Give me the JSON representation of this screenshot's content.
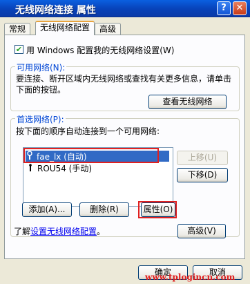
{
  "window": {
    "title": "无线网络连接 属性",
    "help": "?",
    "close": "✕"
  },
  "tabs": [
    {
      "label": "常规"
    },
    {
      "label": "无线网络配置"
    },
    {
      "label": "高级"
    }
  ],
  "use_windows": {
    "checked": true,
    "label": "用 Windows 配置我的无线网络设置(W)"
  },
  "available": {
    "legend": "可用网络(N):",
    "desc": "要连接、断开区域内无线网络或查找有关更多信息，请单击下面的按钮。",
    "view_button": "查看无线网络"
  },
  "preferred": {
    "legend": "首选网络(P):",
    "desc": "按下面的顺序自动连接到一个可用网络:",
    "items": [
      {
        "label": "fae_lx (自动)",
        "icon": "antenna-icon"
      },
      {
        "label": "ROU54 (手动)",
        "icon": "antenna-icon"
      }
    ],
    "up_button": "上移(U)",
    "down_button": "下移(D)",
    "add_button": "添加(A)...",
    "remove_button": "删除(R)",
    "properties_button": "属性(O)"
  },
  "learn": {
    "prefix": "了解",
    "link": "设置无线网络配置",
    "suffix": "。"
  },
  "advanced_button": "高级(V)",
  "ok_button": "确定",
  "cancel_button": "取消",
  "watermark": "www.tplogincn.com",
  "colors": {
    "title_bar": "#0a4fd0",
    "highlight_box": "#e02020",
    "legend_text": "#0046d5"
  }
}
